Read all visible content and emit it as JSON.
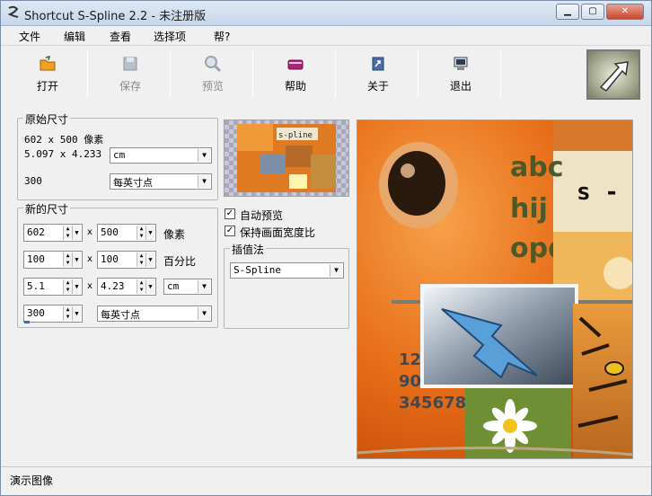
{
  "window": {
    "title": "Shortcut S-Spline 2.2 - 未注册版"
  },
  "menu": [
    "文件",
    "编辑",
    "查看",
    "选择项",
    "帮?"
  ],
  "toolbar": [
    {
      "label": "打开",
      "icon": "open-folder-icon",
      "enabled": true
    },
    {
      "label": "保存",
      "icon": "save-disk-icon",
      "enabled": false
    },
    {
      "label": "预览",
      "icon": "preview-magnifier-icon",
      "enabled": false
    },
    {
      "label": "帮助",
      "icon": "help-book-icon",
      "enabled": true
    },
    {
      "label": "关于",
      "icon": "about-icon",
      "enabled": true
    },
    {
      "label": "退出",
      "icon": "exit-computer-icon",
      "enabled": true
    }
  ],
  "original": {
    "title": "原始尺寸",
    "pixels": "602 x 500 像素",
    "physical": "5.097 x 4.233",
    "unit": "cm",
    "dpi": "300",
    "dpi_unit": "每英寸点"
  },
  "new_size": {
    "title": "新的尺寸",
    "width_px": "602",
    "height_px": "500",
    "px_unit": "像素",
    "width_pct": "100",
    "height_pct": "100",
    "pct_unit": "百分比",
    "width_cm": "5.1",
    "height_cm": "4.23",
    "cm_unit": "cm",
    "dpi": "300",
    "dpi_unit": "每英寸点",
    "x": "x"
  },
  "options": {
    "auto_preview": "自动预览",
    "keep_aspect": "保持画面宽度比",
    "interp_title": "插值法",
    "interp_value": "S-Spline"
  },
  "preview_text": {
    "letters1": "abc",
    "letters2": "hij",
    "letters3": "opqr",
    "s_label": "s -",
    "nums1": "12",
    "nums2": "90",
    "nums3": "345678",
    "thumb_text": "s-pline"
  },
  "status": "演示图像",
  "colors": {
    "title_bg": "#c6d6ea",
    "accent_orange": "#e8751c",
    "dark_green": "#4a5a2a"
  }
}
